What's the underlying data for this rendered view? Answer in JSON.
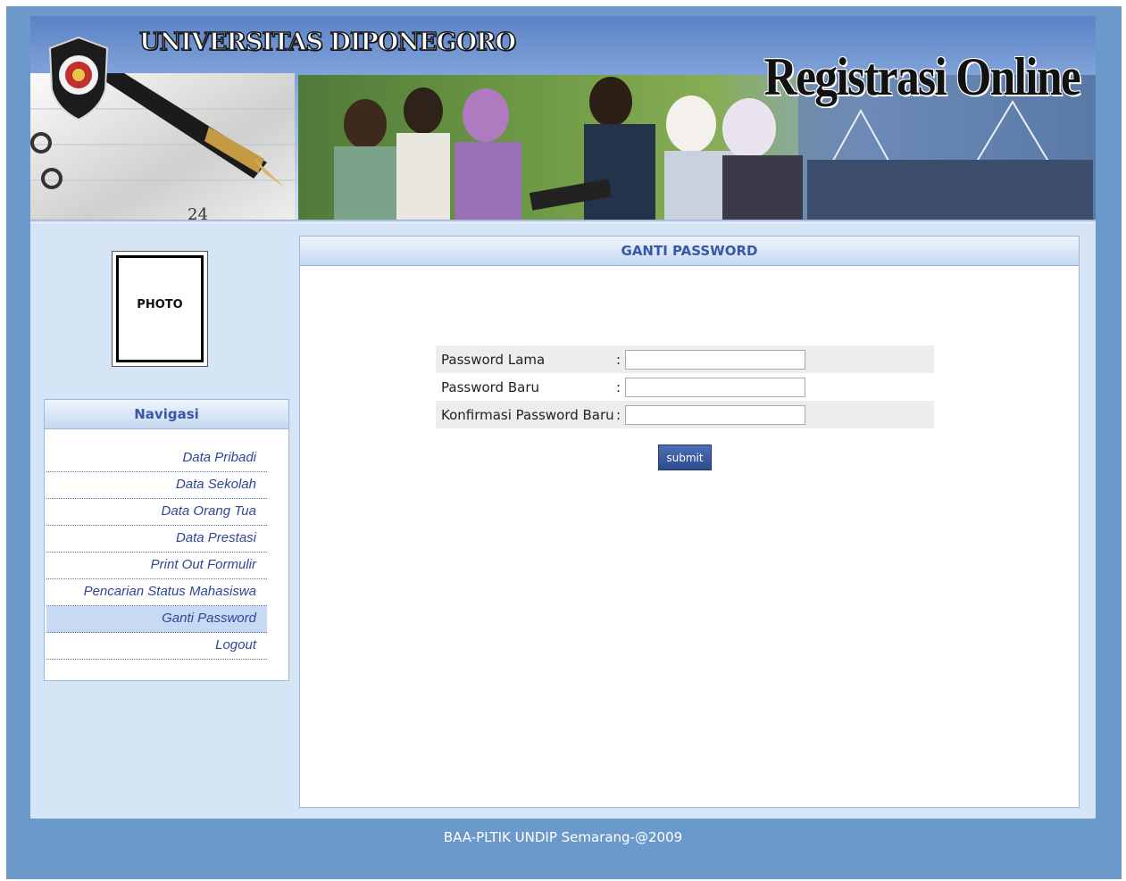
{
  "header": {
    "university": "UNIVERSITAS DIPONEGORO",
    "app_title": "Registrasi Online",
    "pen_number": "24"
  },
  "sidebar": {
    "photo_label": "PHOTO",
    "nav_title": "Navigasi",
    "items": [
      {
        "label": "Data Pribadi",
        "active": false
      },
      {
        "label": "Data Sekolah",
        "active": false
      },
      {
        "label": "Data Orang Tua",
        "active": false
      },
      {
        "label": "Data Prestasi",
        "active": false
      },
      {
        "label": "Print Out Formulir",
        "active": false
      },
      {
        "label": "Pencarian Status Mahasiswa",
        "active": false
      },
      {
        "label": "Ganti Password",
        "active": true
      },
      {
        "label": "Logout",
        "active": false
      }
    ]
  },
  "main": {
    "title": "GANTI PASSWORD",
    "fields": [
      {
        "label": "Password Lama",
        "colon": ":",
        "value": ""
      },
      {
        "label": "Password Baru",
        "colon": ":",
        "value": ""
      },
      {
        "label": "Konfirmasi Password Baru",
        "colon": ":",
        "value": ""
      }
    ],
    "submit_label": "submit"
  },
  "footer": {
    "text": "BAA-PLTIK UNDIP Semarang-@2009"
  },
  "colors": {
    "page_bg": "#6b99cb",
    "content_bg": "#d6e5f5",
    "accent_text": "#3a56a6"
  }
}
